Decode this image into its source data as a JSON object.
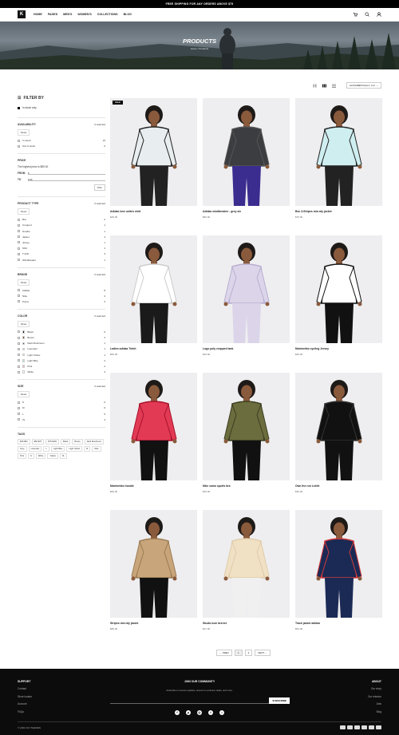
{
  "banner": {
    "text": "FREE SHIPPING FOR ANY ORDERS ABOVE $75"
  },
  "header": {
    "nav": [
      "HOME",
      "PAGES",
      "MEN'S",
      "WOMEN'S",
      "COLLECTIONS",
      "BLOG"
    ]
  },
  "hero": {
    "title": "PRODUCTS",
    "breadcrumb": "Home / Products"
  },
  "toolbar": {
    "sort": "ALPHABETICALLY, A-Z"
  },
  "sidebar": {
    "title": "FILTER BY",
    "in_stock": "In stock only",
    "availability": {
      "title": "AVAILABILITY",
      "selected": "0 selected",
      "reset": "Reset",
      "options": [
        {
          "label": "In stock",
          "count": "15"
        },
        {
          "label": "Out of stock",
          "count": "0"
        }
      ]
    },
    "price": {
      "title": "PRICE",
      "desc": "The highest price is $89.00",
      "from_label": "FROM",
      "to_label": "TO",
      "from_val": "$",
      "to_val": "$ 89",
      "button": "Filter"
    },
    "product_type": {
      "title": "PRODUCT TYPE",
      "selected": "0 selected",
      "reset": "Reset",
      "options": [
        {
          "label": "Bra",
          "count": "2"
        },
        {
          "label": "Cropped",
          "count": "1"
        },
        {
          "label": "Hoodie",
          "count": "1"
        },
        {
          "label": "Jacket",
          "count": "4"
        },
        {
          "label": "Jersey",
          "count": "1"
        },
        {
          "label": "Shirt",
          "count": "1"
        },
        {
          "label": "T-shirt",
          "count": "3"
        },
        {
          "label": "Windbreaker",
          "count": "1"
        }
      ]
    },
    "brand": {
      "title": "BRAND",
      "selected": "0 selected",
      "reset": "Reset",
      "options": [
        {
          "label": "Adidas",
          "count": "8"
        },
        {
          "label": "Nike",
          "count": "4"
        },
        {
          "label": "Puma",
          "count": "3"
        }
      ]
    },
    "color": {
      "title": "COLOR",
      "selected": "0 selected",
      "reset": "Reset",
      "options": [
        {
          "label": "Black",
          "count": "6",
          "color": "#111111"
        },
        {
          "label": "Brown",
          "count": "2",
          "color": "#7a4b2a"
        },
        {
          "label": "Dark Mushroom",
          "count": "1",
          "color": "#5b4a3a"
        },
        {
          "label": "Lavender",
          "count": "1",
          "color": "#dcd3ee"
        },
        {
          "label": "Light Yellow",
          "count": "1",
          "color": "#f4efc8"
        },
        {
          "label": "Light Blue",
          "count": "2",
          "color": "#bfe3ea"
        },
        {
          "label": "Pink",
          "count": "2",
          "color": "#f2b6c6"
        },
        {
          "label": "White",
          "count": "3",
          "color": "#ffffff"
        }
      ]
    },
    "size": {
      "title": "SIZE",
      "selected": "0 selected",
      "reset": "Reset",
      "options": [
        {
          "label": "S",
          "count": "6"
        },
        {
          "label": "M",
          "count": "6"
        },
        {
          "label": "L",
          "count": "5"
        },
        {
          "label": "XL",
          "count": "4"
        }
      ]
    },
    "tags": {
      "title": "TAGS",
      "items": [
        "$25-$50",
        "$50-$75",
        "$75-$100",
        "Black",
        "Brown",
        "Dark Mushroom",
        "Grey",
        "Lavender",
        "L",
        "Light Blue",
        "Light Yellow",
        "M",
        "Nike",
        "Pink",
        "S",
        "White",
        "Yellow",
        "XL"
      ]
    }
  },
  "products": [
    {
      "name": "Adidas love unites shirt",
      "price": "$45.00",
      "badge": "SALE",
      "colors": [
        "#e8eef0",
        "#222",
        "#e94c7c",
        "#7fd0e0"
      ],
      "pants": "#222"
    },
    {
      "name": "Adidas windbreaker - grey six",
      "price": "$84.00",
      "colors": [
        "#3b3d40",
        "#555"
      ],
      "pants": "#3b2c8f"
    },
    {
      "name": "Bsc 3-Stripes rain.rdy jacket",
      "price": "$75.00",
      "colors": [
        "#cfeef0",
        "#222"
      ],
      "pants": "#222"
    },
    {
      "name": "Ladies adidas Tshirt",
      "price": "$50.00",
      "colors": [
        "#ffffff",
        "#ccc"
      ],
      "pants": "#1a1a1a"
    },
    {
      "name": "Logo poly cropped tank",
      "price": "$45.00",
      "colors": [
        "#dcd5ea",
        "#b8aed0"
      ],
      "pants": "#dcd5ea"
    },
    {
      "name": "Marimekko cycling Jersey",
      "price": "$39.00",
      "colors": [
        "#ffffff",
        "#111"
      ],
      "pants": "#111"
    },
    {
      "name": "Marimekko hoodie",
      "price": "$59.00",
      "colors": [
        "#e23a55",
        "#a8122c"
      ],
      "pants": "#111"
    },
    {
      "name": "Nike camo sports bra",
      "price": "$45.00",
      "colors": [
        "#6b6d3e",
        "#3d3f22"
      ],
      "pants": "#111"
    },
    {
      "name": "Own the run t-shirt",
      "price": "$35.00",
      "colors": [
        "#111111",
        "#333"
      ],
      "pants": "#111"
    },
    {
      "name": "Stripes rain.rdy jacket",
      "price": "$89.00",
      "colors": [
        "#c8a57a",
        "#9c7c55"
      ],
      "pants": "#111"
    },
    {
      "name": "Studio luxe bra tee",
      "price": "$27.00",
      "colors": [
        "#f0e0c4",
        "#e0ccaa"
      ],
      "pants": "#f0f0f0"
    },
    {
      "name": "Track jacket adidas",
      "price": "$54.00",
      "colors": [
        "#1b2a55",
        "#d23a3a"
      ],
      "pants": "#1b2a55"
    }
  ],
  "pagination": {
    "prev": "← PREV",
    "pages": [
      "1",
      "2"
    ],
    "next": "NEXT →"
  },
  "footer": {
    "col1": {
      "title": "SUPPORT",
      "links": [
        "Contact",
        "Store locator",
        "Account",
        "FAQs"
      ]
    },
    "newsletter": {
      "title": "JOIN OUR COMMUNITY",
      "desc": "Subscribe to receive updates, access to exclusive deals, and more.",
      "button": "SUBSCRIBE"
    },
    "col3": {
      "title": "ABOUT",
      "links": [
        "Our story",
        "Our mission",
        "Jobs",
        "Blog"
      ]
    },
    "social": [
      "f",
      "p",
      "◎",
      "t",
      "♫"
    ],
    "copyright": "© 2021 KIN THEMES"
  }
}
